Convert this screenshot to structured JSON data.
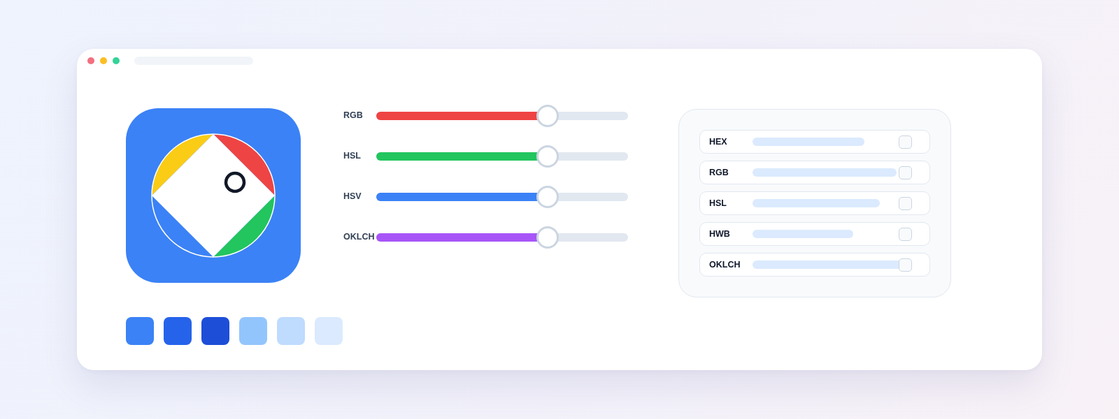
{
  "window": {
    "traffic_lights": [
      {
        "color": "#f2707f"
      },
      {
        "color": "#fbbf24"
      },
      {
        "color": "#34d399"
      }
    ]
  },
  "sliders": [
    {
      "label": "RGB",
      "level": 0.68,
      "color": "#ef4444"
    },
    {
      "label": "HSL",
      "level": 0.68,
      "color": "#22c55e"
    },
    {
      "label": "HSV",
      "level": 0.68,
      "color": "#3b82f6"
    },
    {
      "label": "OKLCH",
      "level": 0.68,
      "color": "#a855f7"
    }
  ],
  "formats": [
    {
      "label": "HEX",
      "checked": false
    },
    {
      "label": "RGB",
      "checked": false
    },
    {
      "label": "HSL",
      "checked": false
    },
    {
      "label": "HWB",
      "checked": false
    },
    {
      "label": "OKLCH",
      "checked": false
    }
  ],
  "swatches": [
    {
      "color": "#3b82f6"
    },
    {
      "color": "#2563eb"
    },
    {
      "color": "#1d4ed8"
    },
    {
      "color": "#93c5fd"
    },
    {
      "color": "#bfdbfe"
    },
    {
      "color": "#dbeafe"
    }
  ]
}
